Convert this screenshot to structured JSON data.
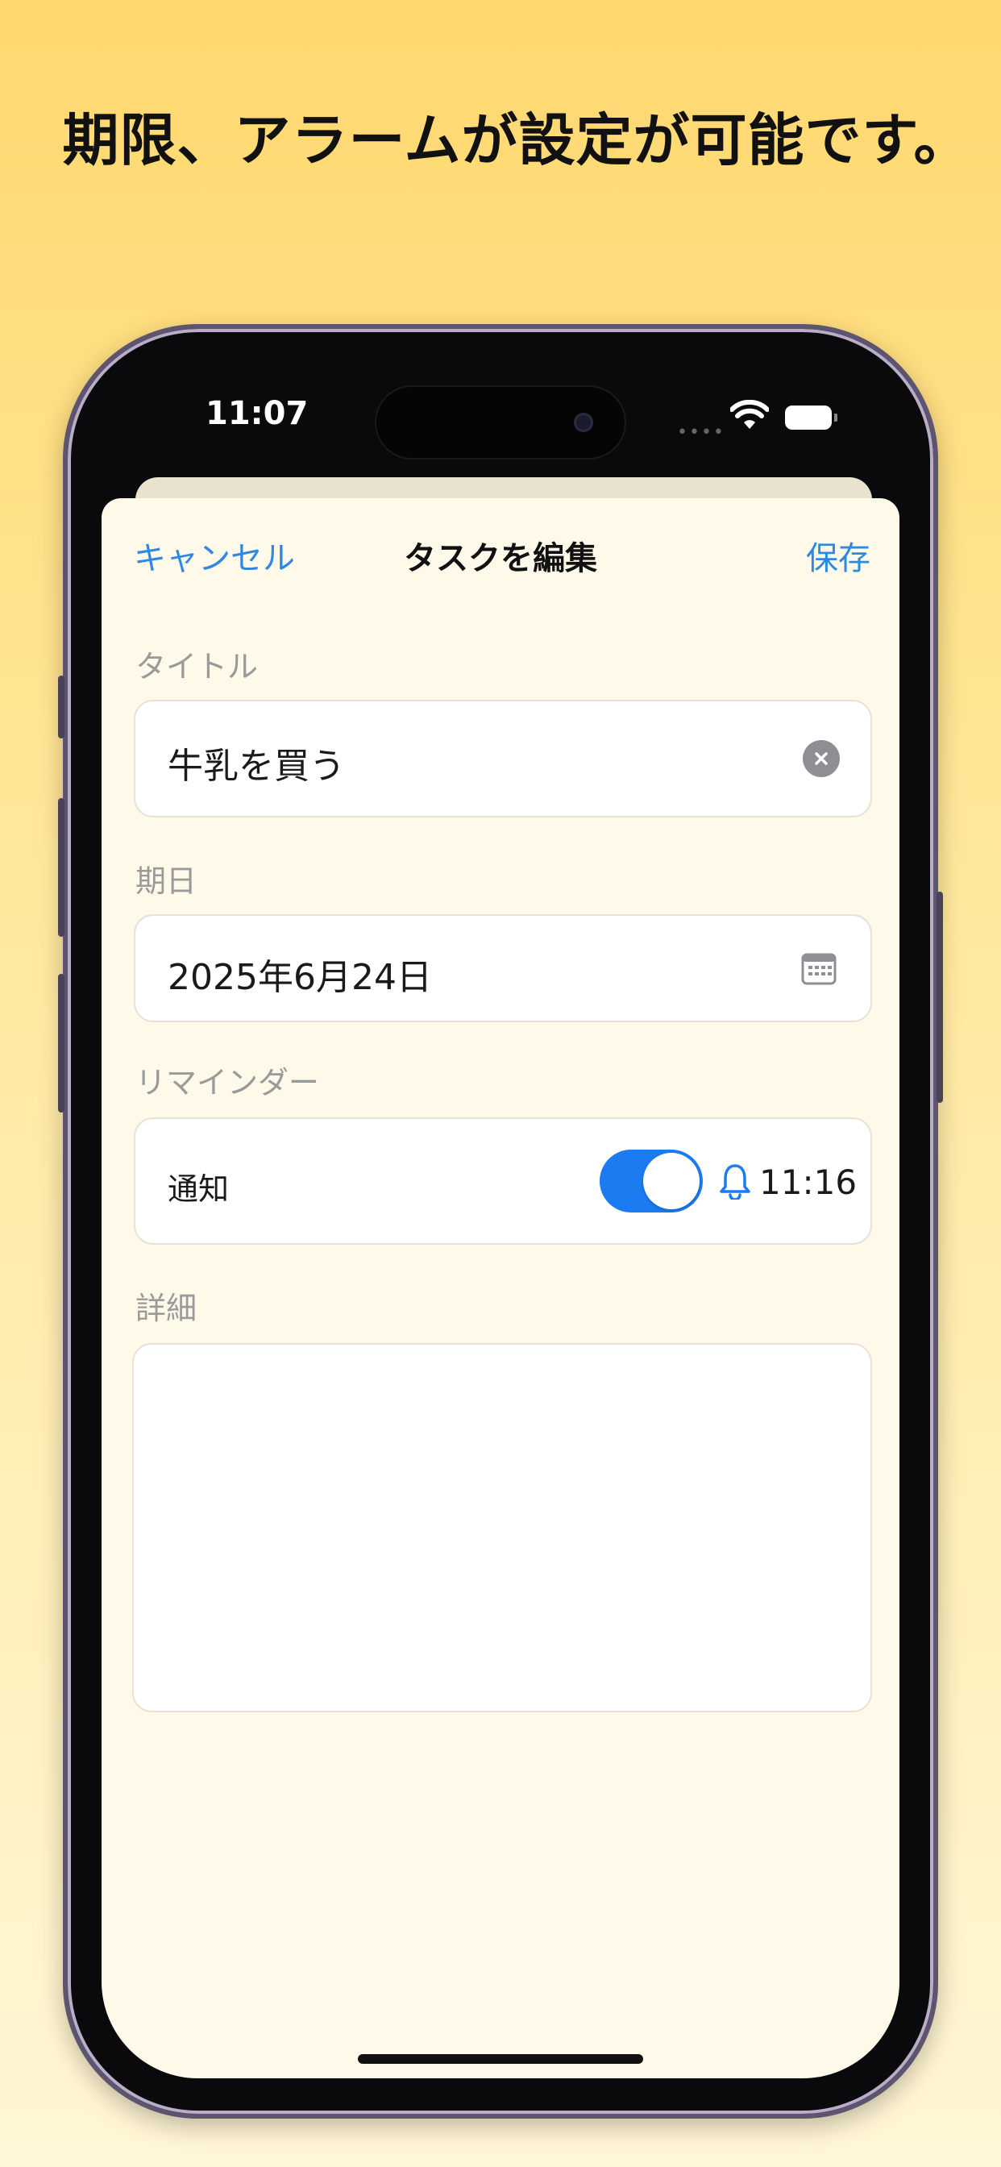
{
  "headline": "期限、アラームが設定が可能です。",
  "status_bar": {
    "time": "11:07"
  },
  "nav": {
    "cancel_label": "キャンセル",
    "title": "タスクを編集",
    "save_label": "保存"
  },
  "form": {
    "title_label": "タイトル",
    "title_value": "牛乳を買う",
    "due_label": "期日",
    "due_value": "2025年6月24日",
    "reminder_label": "リマインダー",
    "notify_label": "通知",
    "notify_enabled": true,
    "reminder_time": "11:16",
    "detail_label": "詳細",
    "detail_value": ""
  },
  "colors": {
    "accent": "#2F89E2",
    "toggle_on": "#1B7CF2",
    "sheet_background": "#FFF9EA",
    "page_gradient_top": "#FFD86E",
    "page_gradient_bottom": "#FFF6D6"
  },
  "icons": [
    "clear-icon",
    "calendar-icon",
    "bell-icon",
    "wifi-icon",
    "battery-icon"
  ]
}
